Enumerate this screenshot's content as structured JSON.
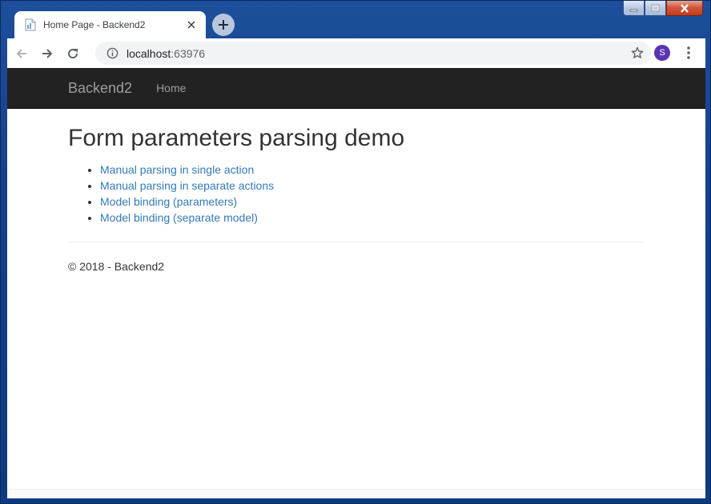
{
  "browser": {
    "tab": {
      "title": "Home Page - Backend2",
      "favicon": "page-icon"
    },
    "new_tab_label": "+",
    "address": {
      "host": "localhost",
      "port": ":63976"
    },
    "profile_initial": "S",
    "colors": {
      "frame": "#1d4f9a",
      "avatar": "#5a35b0"
    }
  },
  "site": {
    "navbar": {
      "brand": "Backend2",
      "items": [
        {
          "label": "Home"
        }
      ]
    },
    "heading": "Form parameters parsing demo",
    "links": [
      {
        "label": "Manual parsing in single action"
      },
      {
        "label": "Manual parsing in separate actions"
      },
      {
        "label": "Model binding (parameters)"
      },
      {
        "label": "Model binding (separate model)"
      }
    ],
    "footer": "© 2018 - Backend2",
    "colors": {
      "navbar_bg": "#222222",
      "link": "#337ab7"
    }
  }
}
